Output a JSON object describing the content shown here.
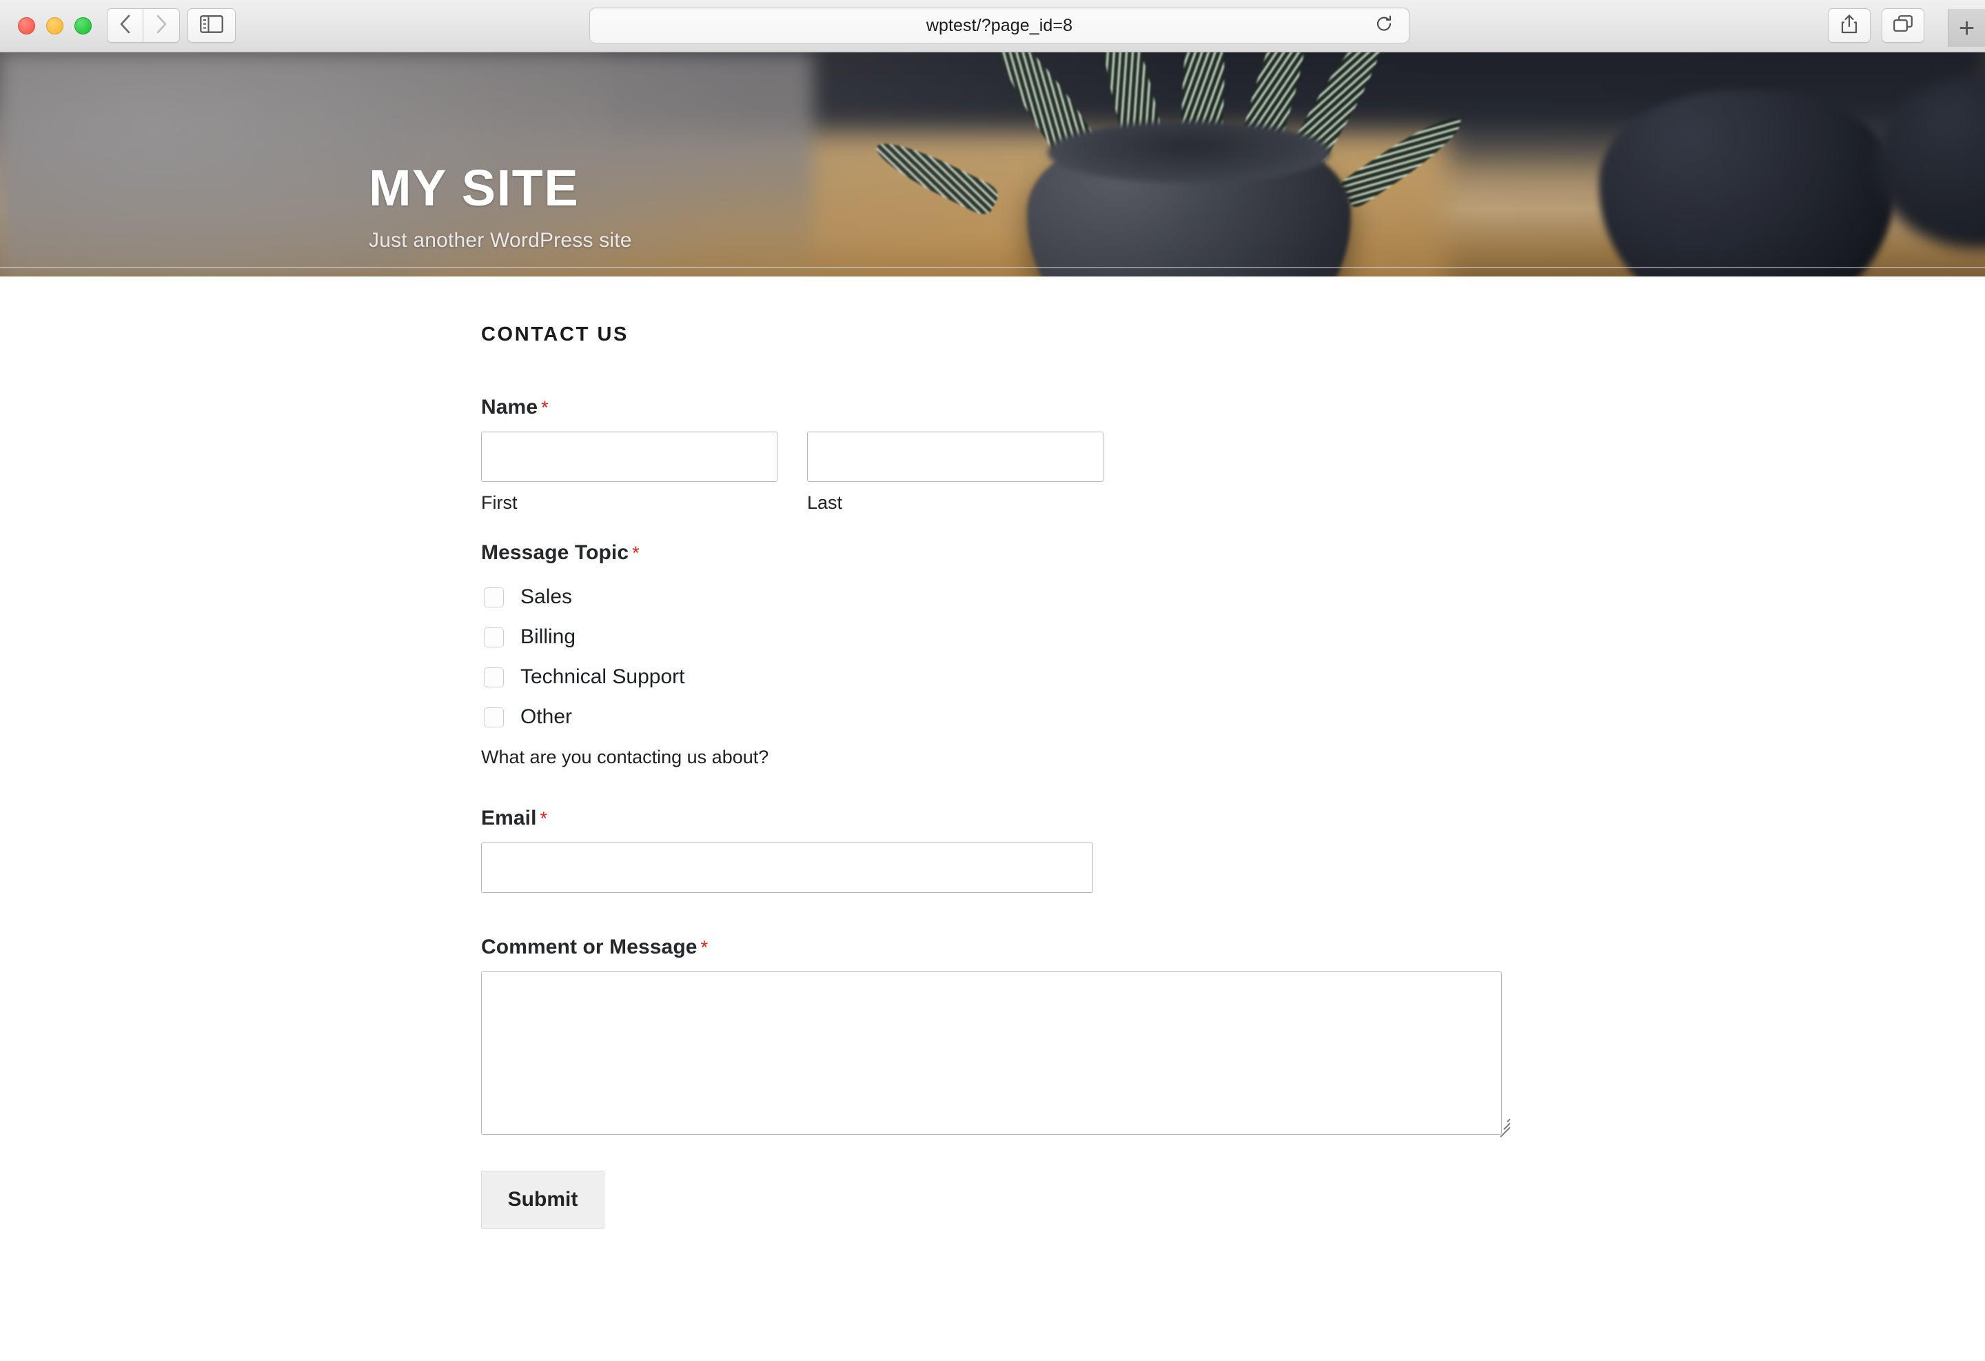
{
  "browser": {
    "url": "wptest/?page_id=8",
    "traffic_lights": [
      "close",
      "minimize",
      "zoom"
    ],
    "controls": {
      "back": "back-icon",
      "forward": "forward-icon",
      "sidebar": "sidebar-toggle-icon",
      "reload": "reload-icon",
      "share": "share-icon",
      "tab_overview": "tab-overview-icon",
      "new_tab": "+"
    }
  },
  "site": {
    "title": "MY SITE",
    "tagline": "Just another WordPress site"
  },
  "page": {
    "heading": "CONTACT US"
  },
  "form": {
    "name": {
      "label": "Name",
      "required_marker": "*",
      "first": {
        "sub_label": "First",
        "value": "",
        "placeholder": ""
      },
      "last": {
        "sub_label": "Last",
        "value": "",
        "placeholder": ""
      }
    },
    "message_topic": {
      "label": "Message Topic",
      "required_marker": "*",
      "options": [
        {
          "label": "Sales",
          "checked": false
        },
        {
          "label": "Billing",
          "checked": false
        },
        {
          "label": "Technical Support",
          "checked": false
        },
        {
          "label": "Other",
          "checked": false
        }
      ],
      "help_text": "What are you contacting us about?"
    },
    "email": {
      "label": "Email",
      "required_marker": "*",
      "value": "",
      "placeholder": ""
    },
    "comment": {
      "label": "Comment or Message",
      "required_marker": "*",
      "value": "",
      "placeholder": ""
    },
    "submit_label": "Submit"
  },
  "colors": {
    "required_red": "#e8201a",
    "text": "#1e2124",
    "heading": "#1b1b1b",
    "input_border": "#b9b9b9",
    "button_bg": "#efefef"
  }
}
